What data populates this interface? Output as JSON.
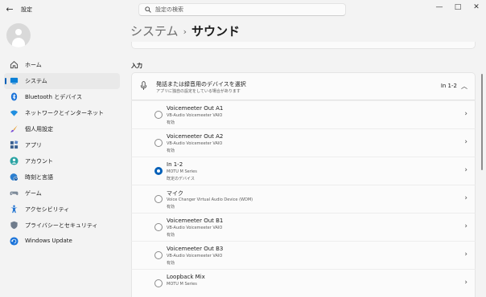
{
  "window": {
    "title": "設定",
    "back_glyph": "←",
    "minimize_glyph": "—",
    "maximize_glyph": "□",
    "close_glyph": "✕"
  },
  "search": {
    "placeholder": "設定の検索",
    "value": ""
  },
  "nav": {
    "items": [
      {
        "label": "ホーム",
        "icon": "home-icon",
        "selected": false
      },
      {
        "label": "システム",
        "icon": "system-icon",
        "selected": true
      },
      {
        "label": "Bluetooth とデバイス",
        "icon": "bluetooth-icon",
        "selected": false
      },
      {
        "label": "ネットワークとインターネット",
        "icon": "wifi-icon",
        "selected": false
      },
      {
        "label": "個人用設定",
        "icon": "brush-icon",
        "selected": false
      },
      {
        "label": "アプリ",
        "icon": "apps-icon",
        "selected": false
      },
      {
        "label": "アカウント",
        "icon": "account-icon",
        "selected": false
      },
      {
        "label": "時刻と言語",
        "icon": "globe-clock-icon",
        "selected": false
      },
      {
        "label": "ゲーム",
        "icon": "gamepad-icon",
        "selected": false
      },
      {
        "label": "アクセシビリティ",
        "icon": "accessibility-icon",
        "selected": false
      },
      {
        "label": "プライバシーとセキュリティ",
        "icon": "shield-icon",
        "selected": false
      },
      {
        "label": "Windows Update",
        "icon": "update-icon",
        "selected": false
      }
    ]
  },
  "breadcrumb": {
    "parent": "システム",
    "separator": "›",
    "current": "サウンド"
  },
  "input_section": {
    "label": "入力",
    "header": {
      "title": "発話または録音用のデバイスを選択",
      "subtitle": "アプリに独自の設定をしている場合があります",
      "value": "In 1-2",
      "chevron": "︿"
    },
    "devices": [
      {
        "name": "Voicemeeter Out A1",
        "detail": "VB-Audio Voicemeeter VAIO",
        "status": "有効",
        "selected": false
      },
      {
        "name": "Voicemeeter Out A2",
        "detail": "VB-Audio Voicemeeter VAIO",
        "status": "有効",
        "selected": false
      },
      {
        "name": "In 1-2",
        "detail": "MOTU M Series",
        "status": "既定のデバイス",
        "selected": true
      },
      {
        "name": "マイク",
        "detail": "Voice Changer Virtual Audio Device (WDM)",
        "status": "有効",
        "selected": false
      },
      {
        "name": "Voicemeeter Out B1",
        "detail": "VB-Audio Voicemeeter VAIO",
        "status": "有効",
        "selected": false
      },
      {
        "name": "Voicemeeter Out B3",
        "detail": "VB-Audio Voicemeeter VAIO",
        "status": "有効",
        "selected": false
      },
      {
        "name": "Loopback Mix",
        "detail": "MOTU M Series",
        "status": "",
        "selected": false
      }
    ],
    "row_chevron": "›"
  },
  "colors": {
    "accent": "#005fb8",
    "background": "#f3f3f3",
    "card": "#fbfbfb"
  }
}
